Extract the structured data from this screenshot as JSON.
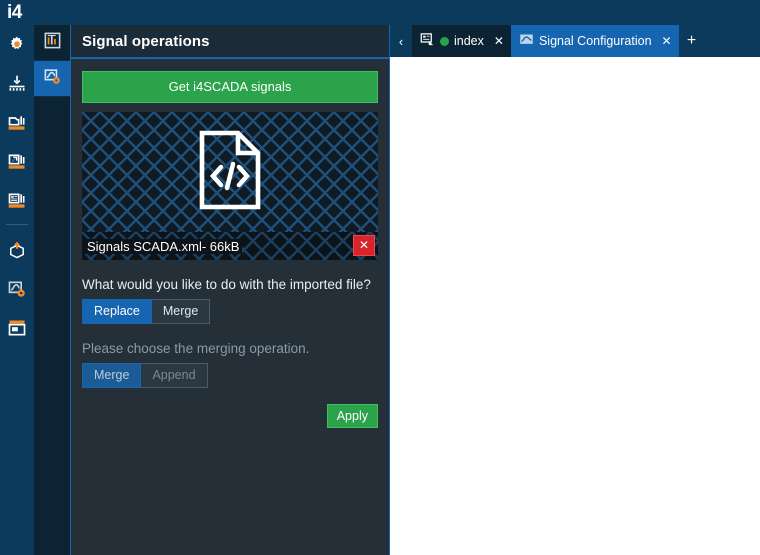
{
  "brand": {
    "label": "i4"
  },
  "left_rail": {
    "items": [
      {
        "name": "settings-gear-icon",
        "label": "Settings"
      },
      {
        "name": "signal-input-icon",
        "label": "Signals"
      },
      {
        "name": "archive-box-icon",
        "label": "Archive"
      },
      {
        "name": "export-arrow-icon",
        "label": "Export"
      },
      {
        "name": "report-list-icon",
        "label": "Reports"
      },
      {
        "name": "deploy-upload-icon",
        "label": "Deploy"
      },
      {
        "name": "signal-config-icon",
        "label": "Signal Configuration"
      },
      {
        "name": "window-panel-icon",
        "label": "Panels"
      }
    ]
  },
  "secondary_rail": {
    "items": [
      {
        "name": "signal-browser-icon",
        "label": "Signal browser",
        "active": false
      },
      {
        "name": "signal-operations-icon",
        "label": "Signal operations",
        "active": true
      }
    ]
  },
  "panel": {
    "title": "Signal operations",
    "get_signals_label": "Get i4SCADA signals",
    "dropzone": {
      "icon": "xml-file-icon"
    },
    "file": {
      "name": "Signals SCADA.xml- 66kB",
      "remove_label": "✕"
    },
    "import_question": "What would you like to do with the imported file?",
    "import_options": [
      {
        "label": "Replace",
        "selected": true
      },
      {
        "label": "Merge",
        "selected": false
      }
    ],
    "merge_question": "Please choose the merging operation.",
    "merge_options": [
      {
        "label": "Merge",
        "selected": true
      },
      {
        "label": "Append",
        "selected": false
      }
    ],
    "apply_label": "Apply"
  },
  "tabstrip": {
    "collapse_label": "‹",
    "add_label": "+",
    "tabs": [
      {
        "label": "index",
        "icon": "page-screen-icon",
        "status_dot": "#2aa34a",
        "active": false,
        "close": "✕"
      },
      {
        "label": "Signal Configuration",
        "icon": "signal-wave-icon",
        "active": true,
        "close": "✕"
      }
    ]
  },
  "colors": {
    "brand_navy": "#0c3a5c",
    "accent_blue": "#1565b0",
    "accent_orange": "#ef8b22",
    "green": "#2aa34a",
    "red": "#d9252a",
    "panel_bg": "#252f38"
  }
}
